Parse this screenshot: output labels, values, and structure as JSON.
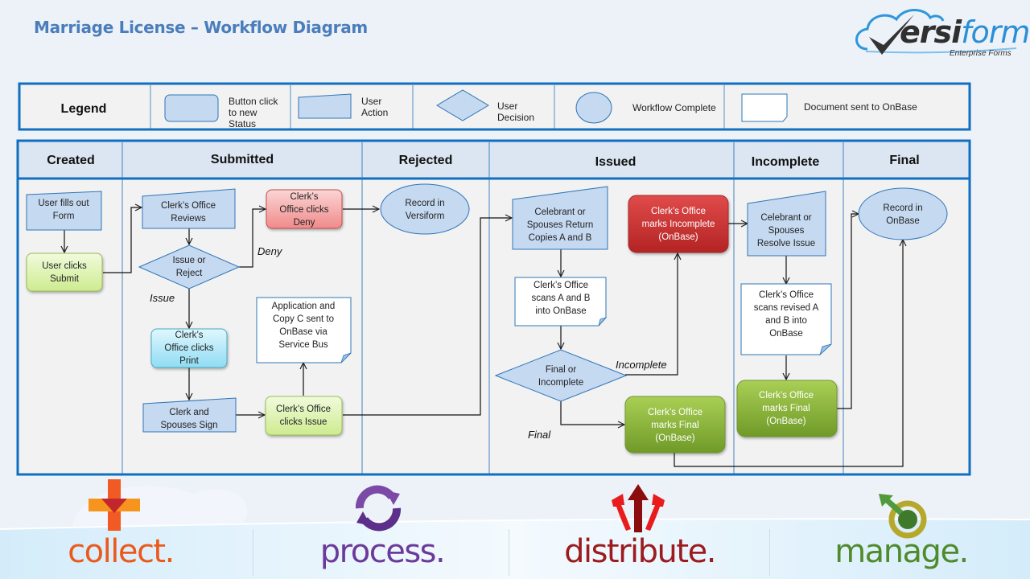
{
  "header": {
    "title": "Marriage License – Workflow Diagram",
    "logo": {
      "brand_dark": "ersi",
      "brand_blue": "form",
      "brand_initial": "V",
      "tagline": "Enterprise Forms"
    }
  },
  "legend": {
    "title": "Legend",
    "items": [
      {
        "shape": "rounded-rect",
        "label_lines": [
          "Button click",
          "to new",
          "Status"
        ]
      },
      {
        "shape": "manual-input",
        "label_lines": [
          "User",
          "Action"
        ]
      },
      {
        "shape": "diamond",
        "label_lines": [
          "User",
          "Decision"
        ]
      },
      {
        "shape": "ellipse",
        "label_lines": [
          "Workflow Complete"
        ]
      },
      {
        "shape": "document",
        "label_lines": [
          "Document sent to OnBase"
        ]
      }
    ]
  },
  "swimlanes": [
    {
      "id": "created",
      "label": "Created"
    },
    {
      "id": "submitted",
      "label": "Submitted"
    },
    {
      "id": "rejected",
      "label": "Rejected"
    },
    {
      "id": "issued",
      "label": "Issued"
    },
    {
      "id": "incomplete",
      "label": "Incomplete"
    },
    {
      "id": "final",
      "label": "Final"
    }
  ],
  "nodes": {
    "user_fills_form": {
      "lines": [
        "User fills out",
        "Form"
      ],
      "shape": "manual-input"
    },
    "user_clicks_submit": {
      "lines": [
        "User clicks",
        "Submit"
      ],
      "shape": "button-green-light"
    },
    "clerk_reviews": {
      "lines": [
        "Clerk’s Office",
        "Reviews"
      ],
      "shape": "manual-input"
    },
    "issue_or_reject": {
      "lines": [
        "Issue or",
        "Reject"
      ],
      "shape": "diamond"
    },
    "clerk_clicks_deny": {
      "lines": [
        "Clerk’s",
        "Office clicks",
        "Deny"
      ],
      "shape": "button-red-light"
    },
    "clerk_clicks_print": {
      "lines": [
        "Clerk’s",
        "Office clicks",
        "Print"
      ],
      "shape": "button-cyan"
    },
    "clerk_spouses_sign": {
      "lines": [
        "Clerk and",
        "Spouses Sign"
      ],
      "shape": "manual-input"
    },
    "clerk_clicks_issue": {
      "lines": [
        "Clerk’s Office",
        "clicks Issue"
      ],
      "shape": "button-green-light"
    },
    "application_copy_c": {
      "lines": [
        "Application and",
        "Copy C sent to",
        "OnBase via",
        "Service Bus"
      ],
      "shape": "document"
    },
    "record_versiform": {
      "lines": [
        "Record in",
        "Versiform"
      ],
      "shape": "ellipse"
    },
    "celebrant_return": {
      "lines": [
        "Celebrant or",
        "Spouses Return",
        "Copies A and B"
      ],
      "shape": "manual-input"
    },
    "clerk_scans_ab": {
      "lines": [
        "Clerk’s Office",
        "scans A and B",
        "into OnBase"
      ],
      "shape": "document"
    },
    "final_or_incomplete": {
      "lines": [
        "Final or",
        "Incomplete"
      ],
      "shape": "diamond"
    },
    "marks_incomplete": {
      "lines": [
        "Clerk’s Office",
        "marks Incomplete",
        "(OnBase)"
      ],
      "shape": "button-red-dark"
    },
    "marks_final_issued": {
      "lines": [
        "Clerk’s Office",
        "marks Final",
        "(OnBase)"
      ],
      "shape": "button-green-dark"
    },
    "celebrant_resolve": {
      "lines": [
        "Celebrant or",
        "Spouses",
        "Resolve Issue"
      ],
      "shape": "manual-input"
    },
    "clerk_scans_revised": {
      "lines": [
        "Clerk’s Office",
        "scans revised A",
        "and B  into",
        "OnBase"
      ],
      "shape": "document"
    },
    "marks_final_incomplete": {
      "lines": [
        "Clerk’s Office",
        "marks Final",
        "(OnBase)"
      ],
      "shape": "button-green-dark"
    },
    "record_onbase": {
      "lines": [
        "Record in",
        "OnBase"
      ],
      "shape": "ellipse"
    }
  },
  "edge_labels": {
    "deny": "Deny",
    "issue": "Issue",
    "incomplete": "Incomplete",
    "final": "Final"
  },
  "footer": {
    "pillars": [
      {
        "word": "collect.",
        "icon": "plus-arrow-icon",
        "color": "#ea5a1c"
      },
      {
        "word": "process.",
        "icon": "cycle-arrows-icon",
        "color": "#6b3a9a"
      },
      {
        "word": "distribute.",
        "icon": "branching-arrows-icon",
        "color": "#9b1b1e"
      },
      {
        "word": "manage.",
        "icon": "target-arrow-icon",
        "color": "#4f8a2b"
      }
    ]
  },
  "colors": {
    "frame_blue": "#0f6fc0",
    "shape_fill": "#c5d9f1",
    "shape_stroke": "#2e75b6",
    "title_blue": "#4a7ebb"
  }
}
